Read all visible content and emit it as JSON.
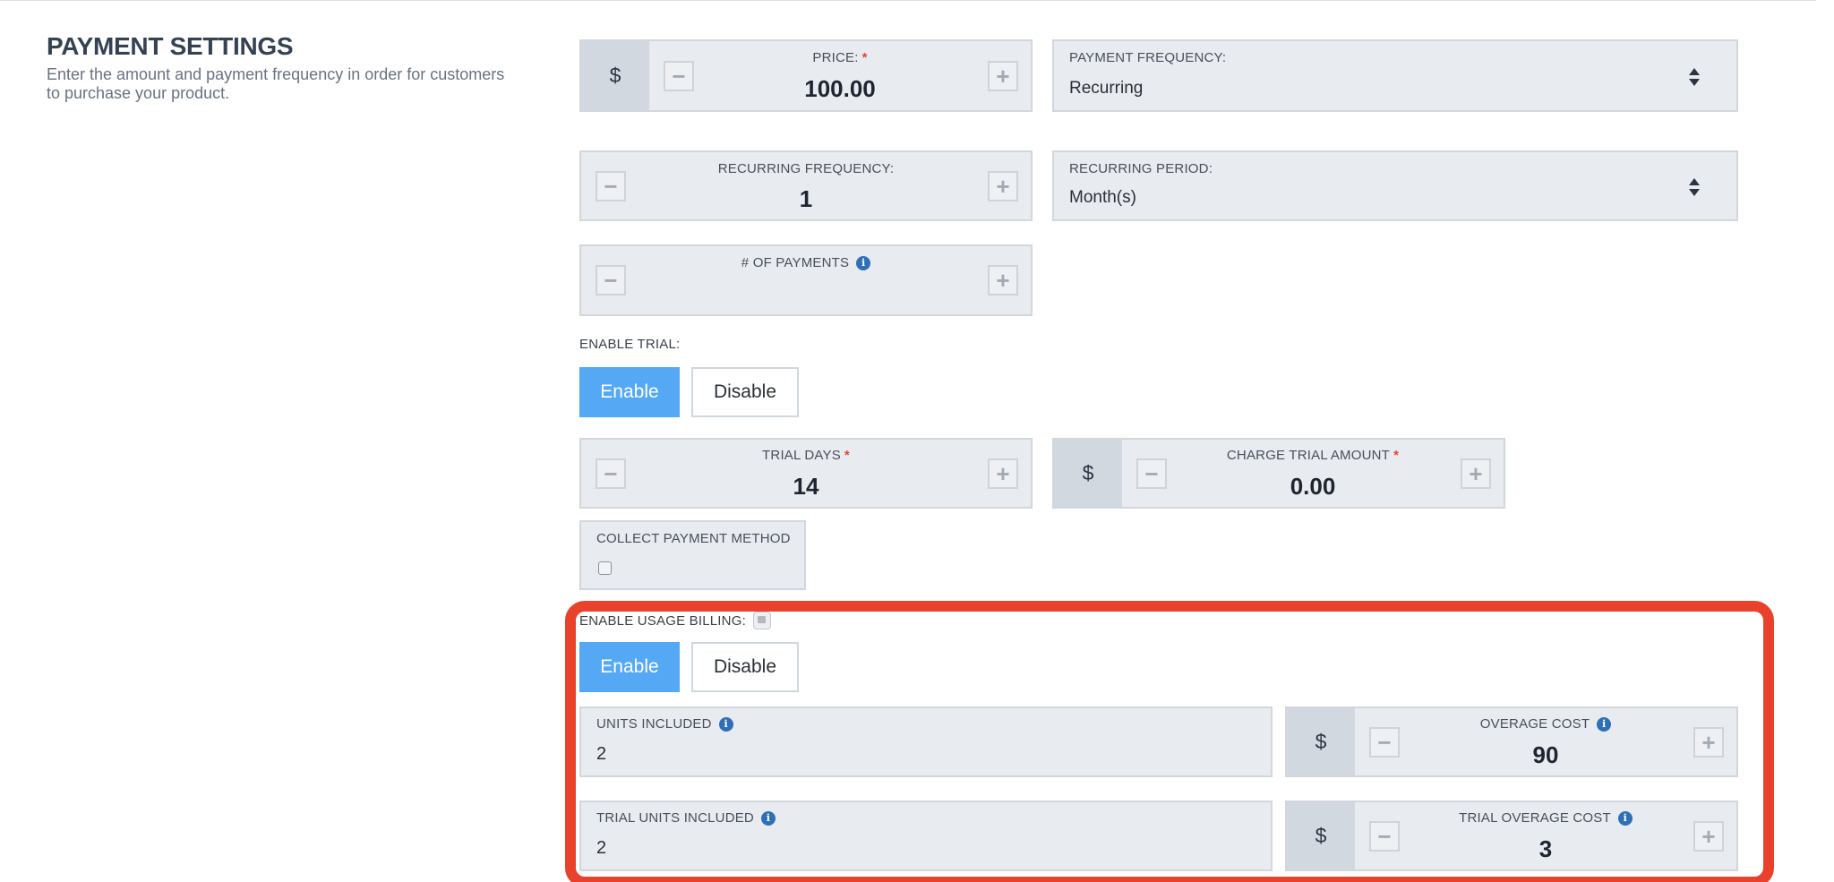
{
  "section": {
    "title": "PAYMENT SETTINGS",
    "description": "Enter the amount and payment frequency in order for customers to purchase your product."
  },
  "price": {
    "currency": "$",
    "label": "PRICE:",
    "required": "*",
    "value": "100.00",
    "minus": "−",
    "plus": "+"
  },
  "payment_frequency": {
    "label": "PAYMENT FREQUENCY:",
    "value": "Recurring"
  },
  "recurring_frequency": {
    "label": "RECURRING FREQUENCY:",
    "value": "1",
    "minus": "−",
    "plus": "+"
  },
  "recurring_period": {
    "label": "RECURRING PERIOD:",
    "value": "Month(s)"
  },
  "num_payments": {
    "label": "# OF PAYMENTS",
    "info": "i",
    "value": "",
    "minus": "−",
    "plus": "+"
  },
  "trial": {
    "label": "ENABLE TRIAL:",
    "enable_label": "Enable",
    "disable_label": "Disable",
    "selected": "Enable"
  },
  "trial_days": {
    "label": "TRIAL DAYS",
    "required": "*",
    "value": "14",
    "minus": "−",
    "plus": "+"
  },
  "charge_trial_amount": {
    "currency": "$",
    "label": "CHARGE TRIAL AMOUNT",
    "required": "*",
    "value": "0.00",
    "minus": "−",
    "plus": "+"
  },
  "collect_payment_method": {
    "label": "COLLECT PAYMENT METHOD",
    "checked": false
  },
  "usage_billing": {
    "label": "ENABLE USAGE BILLING:",
    "enable_label": "Enable",
    "disable_label": "Disable",
    "selected": "Enable",
    "highlight_color": "#e8412c"
  },
  "units_included": {
    "label": "UNITS INCLUDED",
    "info": "i",
    "value": "2"
  },
  "overage_cost": {
    "currency": "$",
    "label": "OVERAGE COST",
    "info": "i",
    "value": "90",
    "minus": "−",
    "plus": "+"
  },
  "trial_units_included": {
    "label": "TRIAL UNITS INCLUDED",
    "info": "i",
    "value": "2"
  },
  "trial_overage_cost": {
    "currency": "$",
    "label": "TRIAL OVERAGE COST",
    "info": "i",
    "value": "3",
    "minus": "−",
    "plus": "+"
  },
  "colors": {
    "accent": "#55a8f3",
    "required": "#e2453b",
    "info": "#2f6fb6",
    "field_bg": "#e8ebef"
  }
}
